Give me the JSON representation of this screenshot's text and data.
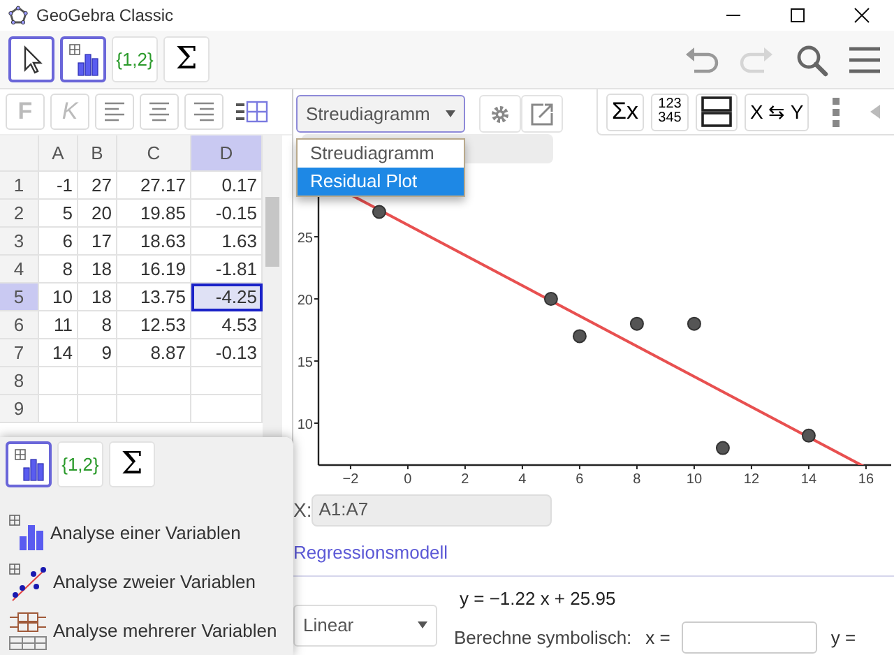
{
  "window": {
    "title": "GeoGebra Classic"
  },
  "toolbar": {
    "tools": [
      {
        "kind": "pointer",
        "selected": true
      },
      {
        "kind": "chart",
        "selected": true
      },
      {
        "kind": "list",
        "label": "{1,2}",
        "selected": false
      },
      {
        "kind": "sum",
        "label": "Σ",
        "selected": false
      }
    ],
    "actions": [
      {
        "kind": "undo",
        "disabled": false
      },
      {
        "kind": "redo",
        "disabled": true
      },
      {
        "kind": "search"
      },
      {
        "kind": "menu"
      }
    ]
  },
  "spreadsheet_style": {
    "buttons": [
      {
        "kind": "text",
        "label": "F",
        "disabled": true
      },
      {
        "kind": "text",
        "label": "K",
        "disabled": true
      },
      {
        "kind": "align-left"
      },
      {
        "kind": "align-center"
      },
      {
        "kind": "align-right"
      },
      {
        "kind": "grid"
      }
    ]
  },
  "spreadsheet": {
    "columns": [
      {
        "label": "A",
        "selected": false
      },
      {
        "label": "B",
        "selected": false
      },
      {
        "label": "C",
        "selected": false
      },
      {
        "label": "D",
        "selected": true
      }
    ],
    "rows": [
      {
        "label": "1",
        "selected": false,
        "cells": [
          "-1",
          "27",
          "27.17",
          "0.17"
        ]
      },
      {
        "label": "2",
        "selected": false,
        "cells": [
          "5",
          "20",
          "19.85",
          "-0.15"
        ]
      },
      {
        "label": "3",
        "selected": false,
        "cells": [
          "6",
          "17",
          "18.63",
          "1.63"
        ]
      },
      {
        "label": "4",
        "selected": false,
        "cells": [
          "8",
          "18",
          "16.19",
          "-1.81"
        ]
      },
      {
        "label": "5",
        "selected": true,
        "cells": [
          "10",
          "18",
          "13.75",
          "-4.25"
        ]
      },
      {
        "label": "6",
        "selected": false,
        "cells": [
          "11",
          "8",
          "12.53",
          "4.53"
        ]
      },
      {
        "label": "7",
        "selected": false,
        "cells": [
          "14",
          "9",
          "8.87",
          "-0.13"
        ]
      },
      {
        "label": "8",
        "selected": false
      },
      {
        "label": "9",
        "selected": false
      }
    ]
  },
  "plot_type": {
    "value": "Streudiagramm",
    "expanded": true,
    "options": [
      {
        "label": "Streudiagramm",
        "highlighted": false
      },
      {
        "label": "Residual Plot",
        "highlighted": true
      }
    ]
  },
  "graphics_buttons": [
    {
      "kind": "settings"
    },
    {
      "kind": "export"
    }
  ],
  "data_tools": [
    {
      "kind": "text",
      "label": "Σx"
    },
    {
      "kind": "stack",
      "label": "123",
      "label_2": "345"
    },
    {
      "kind": "layout"
    },
    {
      "kind": "text",
      "label": "X ⇆ Y"
    },
    {
      "kind": "more"
    },
    {
      "kind": "collapse"
    }
  ],
  "plot": {
    "chart_data": {
      "type": "scatter",
      "x": [
        -1,
        5,
        6,
        8,
        10,
        11,
        14
      ],
      "series": [
        {
          "color": "#555555",
          "values": [
            27,
            20,
            17,
            18,
            18,
            8,
            9
          ]
        }
      ],
      "xlim": [
        -3.12,
        16.88
      ],
      "ylim": [
        6.63,
        33.15
      ],
      "xticks": [
        -2,
        0,
        2,
        4,
        6,
        8,
        10,
        12,
        14,
        16
      ],
      "yticks": [
        10,
        15,
        20,
        25
      ]
    }
  },
  "x_source": {
    "label": "X:",
    "value": "A1:A7"
  },
  "regression": {
    "link": "Regressionsmodell",
    "model": "Linear",
    "equation": "y = −1.22 x + 25.95",
    "evaluate_label": "Berechne symbolisch:",
    "x_label": "x =",
    "y_label": "y ="
  },
  "popup": {
    "tools": [
      {
        "kind": "chart",
        "selected": true
      },
      {
        "kind": "list",
        "label": "{1,2}",
        "selected": false
      },
      {
        "kind": "sum",
        "label": "Σ",
        "selected": false
      }
    ],
    "items": [
      {
        "kind": "one-variable",
        "label": "Analyse einer Variablen"
      },
      {
        "kind": "two-variable",
        "label": "Analyse zweier Variablen"
      },
      {
        "kind": "multi-variable",
        "label": "Analyse mehrerer Variablen"
      }
    ]
  }
}
